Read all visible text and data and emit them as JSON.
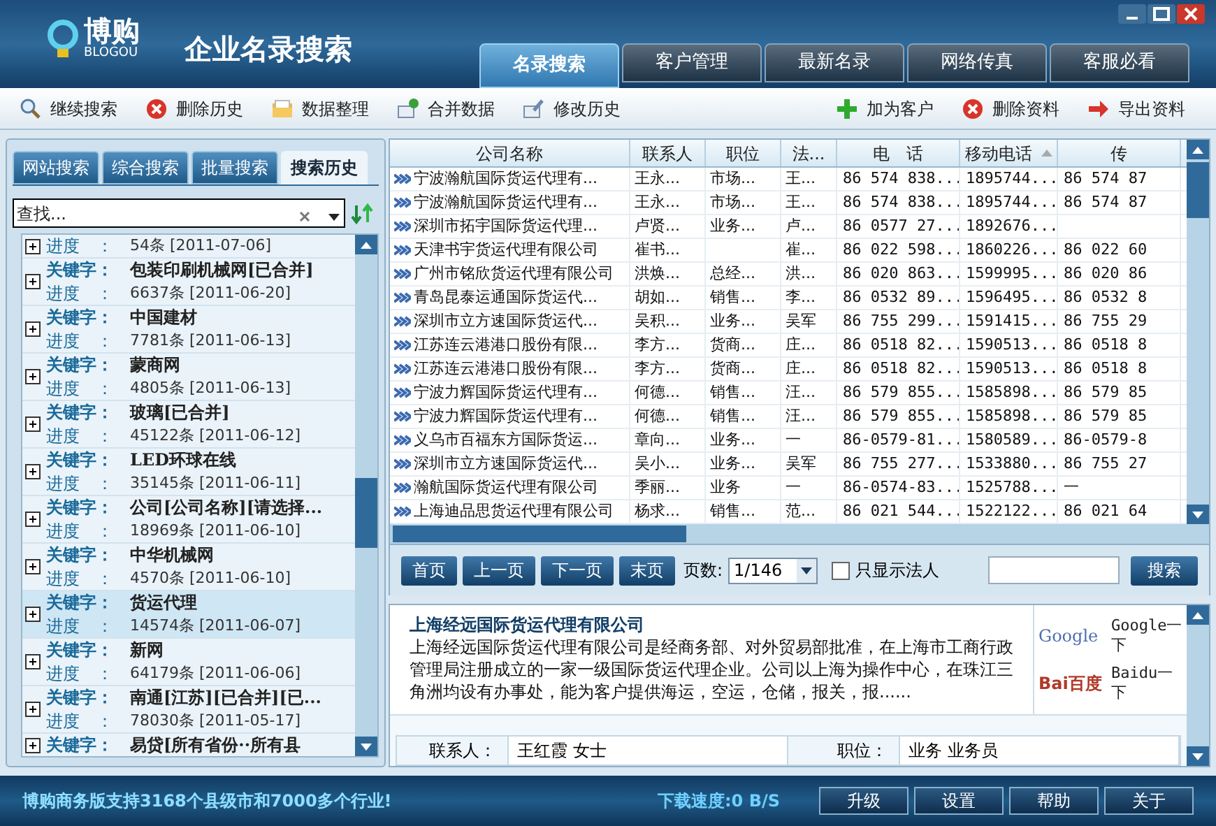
{
  "app": {
    "logo_text": "博购",
    "logo_subtext": "BLOGOU",
    "title": "企业名录搜索"
  },
  "main_tabs": [
    {
      "label": "名录搜索",
      "selected": true
    },
    {
      "label": "客户管理",
      "selected": false
    },
    {
      "label": "最新名录",
      "selected": false
    },
    {
      "label": "网络传真",
      "selected": false
    },
    {
      "label": "客服必看",
      "selected": false
    }
  ],
  "toolbar_left": [
    {
      "label": "继续搜索",
      "kind": "search"
    },
    {
      "label": "删除历史",
      "kind": "delete"
    },
    {
      "label": "数据整理",
      "kind": "folder"
    },
    {
      "label": "合并数据",
      "kind": "merge"
    },
    {
      "label": "修改历史",
      "kind": "edit"
    }
  ],
  "toolbar_right": [
    {
      "label": "加为客户",
      "kind": "add"
    },
    {
      "label": "删除资料",
      "kind": "delete"
    },
    {
      "label": "导出资料",
      "kind": "export"
    }
  ],
  "side_tabs": [
    {
      "label": "网站搜索",
      "selected": false
    },
    {
      "label": "综合搜索",
      "selected": false
    },
    {
      "label": "批量搜索",
      "selected": false
    },
    {
      "label": "搜索历史",
      "selected": true
    }
  ],
  "find": {
    "placeholder": "查找..."
  },
  "history": [
    {
      "progress_label": "进度　：",
      "progress": "54条 [2011-07-06]",
      "selected": false
    },
    {
      "keyword_label": "关键字：",
      "keyword": "包装印刷机械网[已合并]",
      "progress_label": "进度　：",
      "progress": "6637条 [2011-06-20]",
      "selected": false
    },
    {
      "keyword_label": "关键字：",
      "keyword": "中国建材",
      "progress_label": "进度　：",
      "progress": "7781条 [2011-06-13]",
      "selected": false
    },
    {
      "keyword_label": "关键字：",
      "keyword": "蒙商网",
      "progress_label": "进度　：",
      "progress": "4805条 [2011-06-13]",
      "selected": false
    },
    {
      "keyword_label": "关键字：",
      "keyword": "玻璃[已合并]",
      "progress_label": "进度　：",
      "progress": "45122条 [2011-06-12]",
      "selected": false
    },
    {
      "keyword_label": "关键字：",
      "keyword": "LED环球在线",
      "progress_label": "进度　：",
      "progress": "35145条 [2011-06-11]",
      "selected": false
    },
    {
      "keyword_label": "关键字：",
      "keyword": "公司[公司名称][请选择...",
      "progress_label": "进度　：",
      "progress": "18969条 [2011-06-10]",
      "selected": false
    },
    {
      "keyword_label": "关键字：",
      "keyword": "中华机械网",
      "progress_label": "进度　：",
      "progress": "4570条 [2011-06-10]",
      "selected": false
    },
    {
      "keyword_label": "关键字：",
      "keyword": "货运代理",
      "progress_label": "进度　：",
      "progress": "14574条 [2011-06-07]",
      "selected": true
    },
    {
      "keyword_label": "关键字：",
      "keyword": "新网",
      "progress_label": "进度　：",
      "progress": "64179条 [2011-06-06]",
      "selected": false
    },
    {
      "keyword_label": "关键字：",
      "keyword": "南通[江苏][已合并][已...",
      "progress_label": "进度　：",
      "progress": "78030条 [2011-05-17]",
      "selected": false
    },
    {
      "keyword_label": "关键字：",
      "keyword": "易贷[所有省份··所有县",
      "selected": false
    }
  ],
  "table": {
    "columns": [
      {
        "label": "公司名称",
        "sorted": false
      },
      {
        "label": "联系人",
        "sorted": false
      },
      {
        "label": "职位",
        "sorted": false
      },
      {
        "label": "法...",
        "sorted": false
      },
      {
        "label": "电　话",
        "sorted": false
      },
      {
        "label": "移动电话",
        "sorted": true
      },
      {
        "label": "传",
        "sorted": false
      }
    ],
    "rows": [
      [
        "宁波瀚航国际货运代理有...",
        "王永...",
        "市场...",
        "王...",
        "86 574 838...",
        "1895744...",
        "86 574 87"
      ],
      [
        "宁波瀚航国际货运代理有...",
        "王永...",
        "市场...",
        "王...",
        "86 574 838...",
        "1895744...",
        "86 574 87"
      ],
      [
        "深圳市拓宇国际货运代理...",
        "卢贤...",
        "业务...",
        "卢...",
        "86 0577 27...",
        "1892676...",
        null
      ],
      [
        "天津书宇货运代理有限公司",
        "崔书...",
        null,
        "崔...",
        "86 022 598...",
        "1860226...",
        "86 022 60"
      ],
      [
        "广州市铭欣货运代理有限公司",
        "洪焕...",
        "总经...",
        "洪...",
        "86 020 863...",
        "1599995...",
        "86 020 86"
      ],
      [
        "青岛昆泰运通国际货运代...",
        "胡如...",
        "销售...",
        "李...",
        "86 0532 89...",
        "1596495...",
        "86 0532 8"
      ],
      [
        "深圳市立方速国际货运代...",
        "吴积...",
        "业务...",
        "吴军",
        "86 755 299...",
        "1591415...",
        "86 755 29"
      ],
      [
        "江苏连云港港口股份有限...",
        "李方...",
        "货商...",
        "庄...",
        "86 0518 82...",
        "1590513...",
        "86 0518 8"
      ],
      [
        "江苏连云港港口股份有限...",
        "李方...",
        "货商...",
        "庄...",
        "86 0518 82...",
        "1590513...",
        "86 0518 8"
      ],
      [
        "宁波力辉国际货运代理有...",
        "何德...",
        "销售...",
        "汪...",
        "86 579 855...",
        "1585898...",
        "86 579 85"
      ],
      [
        "宁波力辉国际货运代理有...",
        "何德...",
        "销售...",
        "汪...",
        "86 579 855...",
        "1585898...",
        "86 579 85"
      ],
      [
        "义乌市百福东方国际货运...",
        "章向...",
        "业务...",
        "一",
        "86-0579-81...",
        "1580589...",
        "86-0579-8"
      ],
      [
        "深圳市立方速国际货运代...",
        "吴小...",
        "业务...",
        "吴军",
        "86 755 277...",
        "1533880...",
        "86 755 27"
      ],
      [
        "瀚航国际货运代理有限公司",
        "季丽...",
        "业务",
        "一",
        "86-0574-83...",
        "1525788...",
        "一"
      ],
      [
        "上海迪品思货运代理有限公司",
        "杨求...",
        "销售...",
        "范...",
        "86 021 544...",
        "1522122...",
        "86 021 64"
      ]
    ]
  },
  "pager": {
    "buttons": [
      "首页",
      "上一页",
      "下一页",
      "末页"
    ],
    "page_label": "页数:",
    "page": "1/146",
    "only_legal": {
      "label": "只显示法人",
      "checked": false
    },
    "search_button": "搜索"
  },
  "detail": {
    "company": "上海经远国际货运代理有限公司",
    "description": "上海经远国际货运代理有限公司是经商务部、对外贸易部批准，在上海市工商行政管理局注册成立的一家一级国际货运代理企业。公司以上海为操作中心，在珠江三角洲均设有办事处，能为客户提供海运，空运，仓储，报关，报......",
    "engines": [
      {
        "logo": "Google",
        "link": "Google一下",
        "kind": "google"
      },
      {
        "logo": "Bai百度",
        "link": "Baidu一下",
        "kind": "baidu"
      }
    ],
    "fields": [
      {
        "label": "联系人：",
        "value": "王红霞 女士"
      },
      {
        "label": "职位：",
        "value": "业务 业务员"
      }
    ]
  },
  "status_bar": {
    "message": "博购商务版支持3168个县级市和7000多个行业!",
    "speed": "下载速度:0 B/S",
    "buttons": [
      "升级",
      "设置",
      "帮助",
      "关于"
    ]
  }
}
